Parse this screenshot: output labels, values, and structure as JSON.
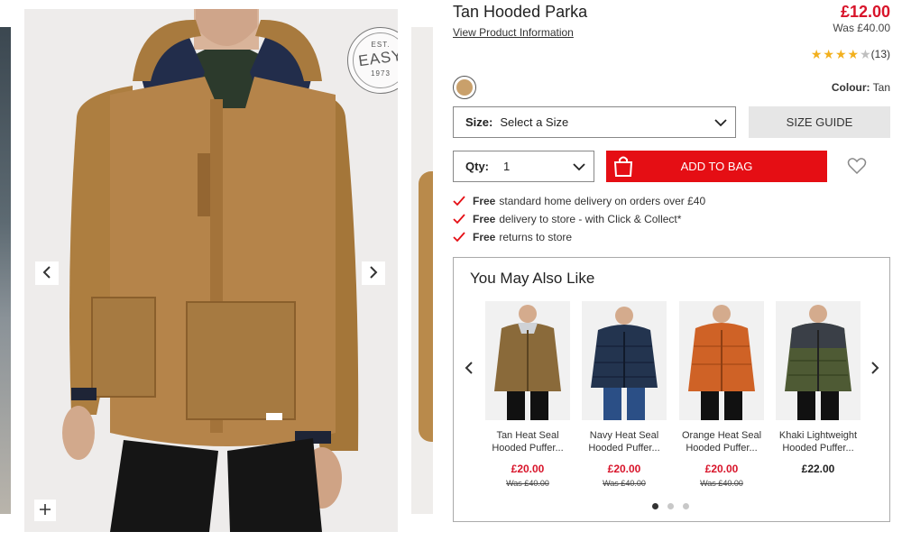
{
  "product": {
    "title": "Tan Hooded Parka",
    "view_info_link": "View Product Information",
    "price": "£12.00",
    "was_price": "Was £40.00",
    "rating": {
      "stars": 4,
      "max": 5,
      "count_label": "(13)"
    },
    "colour_label": "Colour:",
    "colour_value": "Tan",
    "swatch_color": "#c9a06b"
  },
  "gallery": {
    "badge": {
      "top": "EST.",
      "word": "EASY",
      "year": "1973"
    },
    "prev_icon": "chevron-left-icon",
    "next_icon": "chevron-right-icon",
    "zoom_icon": "plus-icon"
  },
  "size_select": {
    "label": "Size:",
    "value": "Select a Size"
  },
  "size_guide_label": "SIZE GUIDE",
  "qty_select": {
    "label": "Qty:",
    "value": "1"
  },
  "add_to_bag_label": "ADD TO BAG",
  "benefits": [
    {
      "bold": "Free",
      "text": "standard home delivery on orders over £40"
    },
    {
      "bold": "Free",
      "text": "delivery to store - with Click & Collect*"
    },
    {
      "bold": "Free",
      "text": "returns to store"
    }
  ],
  "recommendations": {
    "title": "You May Also Like",
    "items": [
      {
        "name_line1": "Tan Heat Seal",
        "name_line2": "Hooded Puffer...",
        "price": "£20.00",
        "was": "Was £40.00",
        "color": "#8a6a3a"
      },
      {
        "name_line1": "Navy Heat Seal",
        "name_line2": "Hooded Puffer...",
        "price": "£20.00",
        "was": "Was £40.00",
        "color": "#23344f"
      },
      {
        "name_line1": "Orange Heat Seal",
        "name_line2": "Hooded Puffer...",
        "price": "£20.00",
        "was": "Was £40.00",
        "color": "#cf6226"
      },
      {
        "name_line1": "Khaki Lightweight",
        "name_line2": "Hooded Puffer...",
        "price": "£22.00",
        "was": "",
        "color": "#4e5a34"
      }
    ],
    "dots": 3,
    "active_dot": 1
  },
  "colors": {
    "accent_red": "#e50e14",
    "price_red": "#d8142a",
    "star": "#f2b01e"
  }
}
